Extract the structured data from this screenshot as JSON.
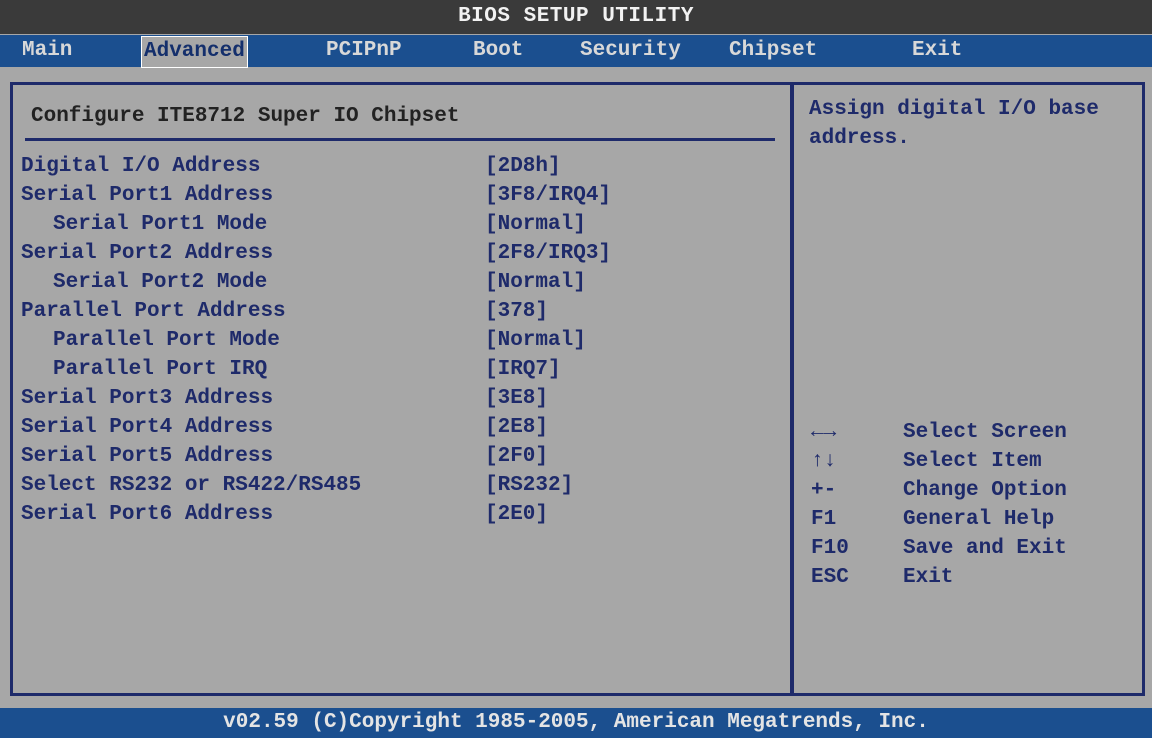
{
  "title": "BIOS SETUP UTILITY",
  "menu": [
    "Main",
    "Advanced",
    "PCIPnP",
    "Boot",
    "Security",
    "Chipset",
    "Exit"
  ],
  "active_menu": "Advanced",
  "section_title": "Configure ITE8712 Super IO Chipset",
  "settings": [
    {
      "label": "Digital I/O Address",
      "value": "[2D8h]",
      "indent": false
    },
    {
      "label": "Serial Port1 Address",
      "value": "[3F8/IRQ4]",
      "indent": false
    },
    {
      "label": "Serial Port1 Mode",
      "value": "[Normal]",
      "indent": true
    },
    {
      "label": "Serial Port2 Address",
      "value": "[2F8/IRQ3]",
      "indent": false
    },
    {
      "label": "Serial Port2 Mode",
      "value": "[Normal]",
      "indent": true
    },
    {
      "label": "Parallel Port Address",
      "value": "[378]",
      "indent": false
    },
    {
      "label": "Parallel Port Mode",
      "value": "[Normal]",
      "indent": true
    },
    {
      "label": "Parallel Port IRQ",
      "value": "[IRQ7]",
      "indent": true
    },
    {
      "label": "Serial Port3 Address",
      "value": "[3E8]",
      "indent": false
    },
    {
      "label": "Serial Port4 Address",
      "value": "[2E8]",
      "indent": false
    },
    {
      "label": "Serial Port5 Address",
      "value": "[2F0]",
      "indent": false
    },
    {
      "label": "Select RS232 or RS422/RS485",
      "value": "[RS232]",
      "indent": false
    },
    {
      "label": "Serial Port6 Address",
      "value": "[2E0]",
      "indent": false
    }
  ],
  "help_text": "Assign digital I/O base address.",
  "keys": [
    {
      "key": "←→",
      "desc": "Select Screen"
    },
    {
      "key": "↑↓",
      "desc": "Select Item"
    },
    {
      "key": "+-",
      "desc": "Change Option"
    },
    {
      "key": "F1",
      "desc": "General Help"
    },
    {
      "key": "F10",
      "desc": "Save and Exit"
    },
    {
      "key": "ESC",
      "desc": "Exit"
    }
  ],
  "footer": "v02.59 (C)Copyright 1985-2005, American Megatrends, Inc.",
  "colors": {
    "background": "#a7a7a7",
    "menu_bar": "#1b4f8f",
    "title_bar": "#3a3a3a",
    "text": "#1e2a6a"
  }
}
